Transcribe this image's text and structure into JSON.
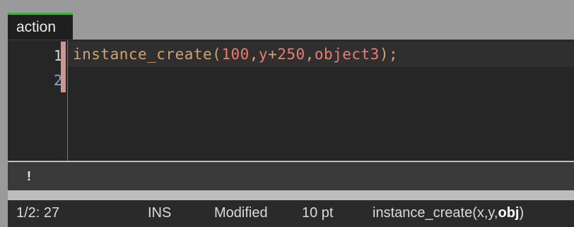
{
  "tab": {
    "label": "action"
  },
  "editor": {
    "line_numbers": [
      "1",
      "2"
    ],
    "line1_tokens": {
      "fn": "instance_create",
      "open": "(",
      "arg1": "100",
      "comma1": ",",
      "var": "y",
      "plus": "+",
      "num2": "250",
      "comma2": ",",
      "obj": "object3",
      "close": ");"
    }
  },
  "message": {
    "icon_glyph": "!"
  },
  "status": {
    "position": "1/2: 27",
    "mode": "INS",
    "modified": "Modified",
    "font_size": "10 pt",
    "hint_prefix": "instance_create(x,y,",
    "hint_bold": "obj",
    "hint_suffix": ")"
  },
  "colors": {
    "tab_accent": "#3fae3f",
    "function": "#d3a26b",
    "literal": "#f07b6f",
    "change_bar": "#c69a93"
  }
}
